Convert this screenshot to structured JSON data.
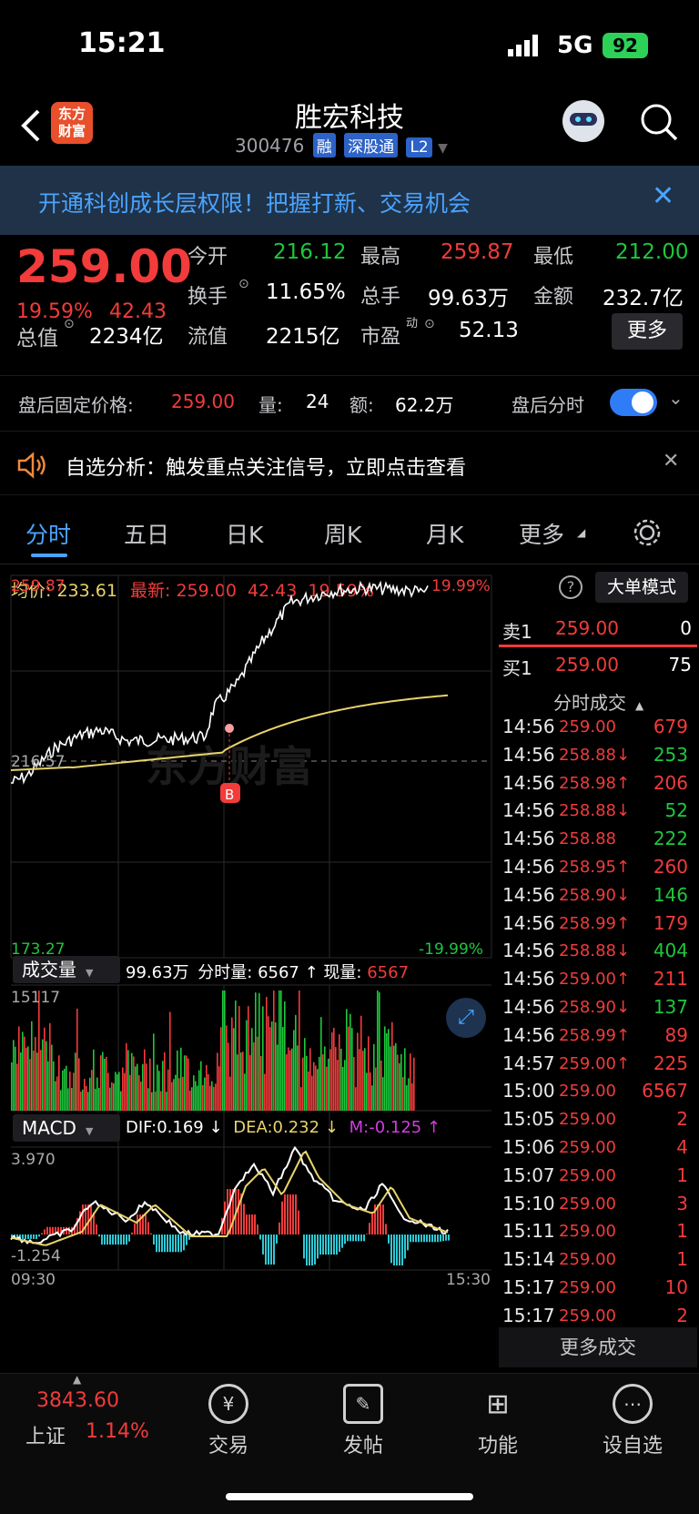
{
  "status": {
    "time": "15:21",
    "network": "5G",
    "battery": "92"
  },
  "header": {
    "title": "胜宏科技",
    "code": "300476",
    "badges": [
      "融",
      "深股通",
      "L2"
    ],
    "logo_line1": "东方",
    "logo_line2": "财富"
  },
  "banner": {
    "text": "开通科创成长层权限！把握打新、交易机会"
  },
  "quote": {
    "price": "259.00",
    "pct": "19.59%",
    "change": "42.43",
    "open_label": "今开",
    "open": "216.12",
    "high_label": "最高",
    "high": "259.87",
    "low_label": "最低",
    "low": "212.00",
    "turnover_label": "换手",
    "turnover": "11.65%",
    "vol_label": "总手",
    "vol": "99.63万",
    "amount_label": "金额",
    "amount": "232.7亿",
    "mcap_label": "总值",
    "mcap": "2234亿",
    "float_label": "流值",
    "float": "2215亿",
    "pe_label": "市盈",
    "pe_sup": "动",
    "pe": "52.13",
    "more": "更多"
  },
  "afterhours": {
    "label": "盘后固定价格:",
    "price": "259.00",
    "vol_label": "量:",
    "vol": "24",
    "amt_label": "额:",
    "amt": "62.2万",
    "toggle_label": "盘后分时"
  },
  "alert": {
    "text": "自选分析：触发重点关注信号，立即点击查看"
  },
  "tabs": [
    "分时",
    "五日",
    "日K",
    "周K",
    "月K",
    "更多"
  ],
  "chartinfo": {
    "avg_label": "均价:",
    "avg": "233.61",
    "latest_label": "最新:",
    "latest": "259.00",
    "chg": "42.43",
    "pct": "19.59%",
    "mode": "大单模式"
  },
  "chart": {
    "ymax": "259.87",
    "ymin": "173.27",
    "pmax": "19.99%",
    "pmin": "-19.99%",
    "mid": "216.57",
    "marker": "B",
    "watermark": "东方财富"
  },
  "volume": {
    "label": "成交量",
    "total": "99.63万",
    "minute_label": "分时量:",
    "minute": "6567",
    "now_label": "现量:",
    "now": "6567",
    "max": "15117"
  },
  "macd": {
    "label": "MACD",
    "dif": "DIF:0.169 ↓",
    "dea": "DEA:0.232 ↓",
    "m": "M:-0.125 ↑",
    "top": "3.970",
    "bottom": "-1.254",
    "t_start": "09:30",
    "t_end": "15:30"
  },
  "orderbook": {
    "sell_label": "卖1",
    "sell_price": "259.00",
    "sell_vol": "0",
    "buy_label": "买1",
    "buy_price": "259.00",
    "buy_vol": "75",
    "ticks_label": "分时成交",
    "more": "更多成交"
  },
  "ticks": [
    {
      "t": "14:56",
      "p": "259.00",
      "a": "679",
      "pc": "red",
      "ac": "red"
    },
    {
      "t": "14:56",
      "p": "258.88↓",
      "a": "253",
      "pc": "red",
      "ac": "green"
    },
    {
      "t": "14:56",
      "p": "258.98↑",
      "a": "206",
      "pc": "red",
      "ac": "red"
    },
    {
      "t": "14:56",
      "p": "258.88↓",
      "a": "52",
      "pc": "red",
      "ac": "green"
    },
    {
      "t": "14:56",
      "p": "258.88",
      "a": "222",
      "pc": "red",
      "ac": "green"
    },
    {
      "t": "14:56",
      "p": "258.95↑",
      "a": "260",
      "pc": "red",
      "ac": "red"
    },
    {
      "t": "14:56",
      "p": "258.90↓",
      "a": "146",
      "pc": "red",
      "ac": "green"
    },
    {
      "t": "14:56",
      "p": "258.99↑",
      "a": "179",
      "pc": "red",
      "ac": "red"
    },
    {
      "t": "14:56",
      "p": "258.88↓",
      "a": "404",
      "pc": "red",
      "ac": "green"
    },
    {
      "t": "14:56",
      "p": "259.00↑",
      "a": "211",
      "pc": "red",
      "ac": "red"
    },
    {
      "t": "14:56",
      "p": "258.90↓",
      "a": "137",
      "pc": "red",
      "ac": "green"
    },
    {
      "t": "14:56",
      "p": "258.99↑",
      "a": "89",
      "pc": "red",
      "ac": "red"
    },
    {
      "t": "14:57",
      "p": "259.00↑",
      "a": "225",
      "pc": "red",
      "ac": "red"
    },
    {
      "t": "15:00",
      "p": "259.00",
      "a": "6567",
      "pc": "red",
      "ac": "red"
    },
    {
      "t": "15:05",
      "p": "259.00",
      "a": "2",
      "pc": "red",
      "ac": "red"
    },
    {
      "t": "15:06",
      "p": "259.00",
      "a": "4",
      "pc": "red",
      "ac": "red"
    },
    {
      "t": "15:07",
      "p": "259.00",
      "a": "1",
      "pc": "red",
      "ac": "red"
    },
    {
      "t": "15:10",
      "p": "259.00",
      "a": "3",
      "pc": "red",
      "ac": "red"
    },
    {
      "t": "15:11",
      "p": "259.00",
      "a": "1",
      "pc": "red",
      "ac": "red"
    },
    {
      "t": "15:14",
      "p": "259.00",
      "a": "1",
      "pc": "red",
      "ac": "red"
    },
    {
      "t": "15:17",
      "p": "259.00",
      "a": "10",
      "pc": "red",
      "ac": "red"
    },
    {
      "t": "15:17",
      "p": "259.00",
      "a": "2",
      "pc": "red",
      "ac": "red"
    }
  ],
  "index": {
    "value": "3843.60",
    "name": "上证",
    "pct": "1.14%"
  },
  "nav": [
    "交易",
    "发帖",
    "功能",
    "设自选"
  ],
  "colors": {
    "up": "#f23b3b",
    "down": "#1ec73d",
    "avg_line": "#e8d36a",
    "banner_text": "#4aa3ff",
    "toggle": "#2f7df6",
    "macd_dif": "#ffffff",
    "macd_dea": "#e8d36a",
    "macd_neg": "#2ec9d6",
    "macd_m": "#d23ce0"
  }
}
